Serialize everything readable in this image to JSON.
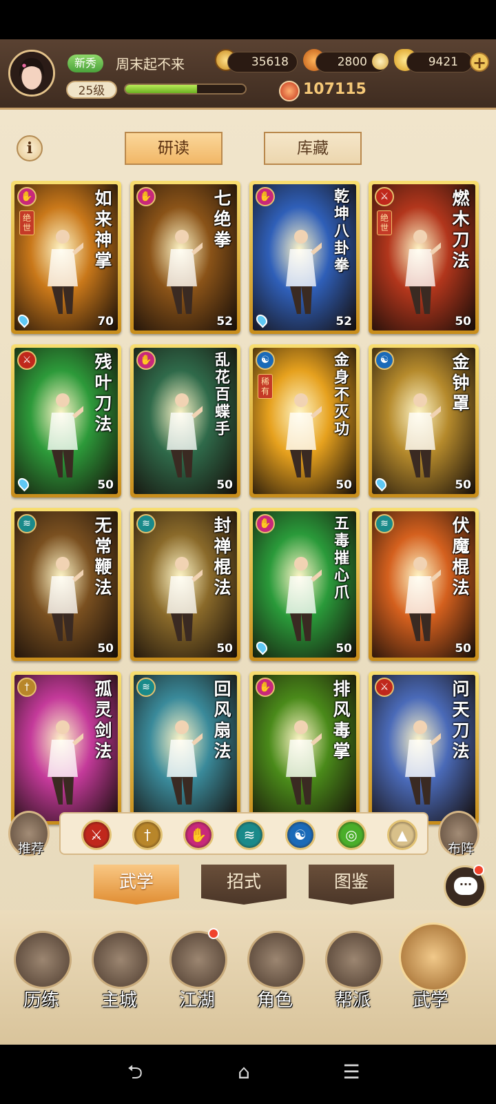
{
  "header": {
    "rank_badge": "新秀",
    "player_name": "周末起不来",
    "level": "25级",
    "exp_progress": 0.6,
    "coins": "35618",
    "leaf_currency": "2800",
    "gold_ingots": "9421",
    "add_label": "+",
    "combat_power": "107115"
  },
  "info_label": "i",
  "subtabs": [
    {
      "label": "研读",
      "active": true
    },
    {
      "label": "库藏",
      "active": false
    }
  ],
  "cards": [
    {
      "name": "如来神掌",
      "level": "70",
      "type": "palm",
      "rarity": "绝世",
      "drop": true,
      "color": "#c9781a"
    },
    {
      "name": "七绝拳",
      "level": "52",
      "type": "palm",
      "rarity": "",
      "drop": false,
      "color": "#8a5318"
    },
    {
      "name": "乾坤八卦拳",
      "level": "52",
      "type": "palm",
      "rarity": "",
      "drop": true,
      "color": "#2f5fb8"
    },
    {
      "name": "燃木刀法",
      "level": "50",
      "type": "blade",
      "rarity": "绝世",
      "drop": false,
      "color": "#b2361c"
    },
    {
      "name": "残叶刀法",
      "level": "50",
      "type": "blade",
      "rarity": "",
      "drop": true,
      "color": "#2d9a3a"
    },
    {
      "name": "乱花百蝶手",
      "level": "50",
      "type": "palm",
      "rarity": "",
      "drop": false,
      "color": "#2f6a4a"
    },
    {
      "name": "金身不灭功",
      "level": "50",
      "type": "inner",
      "rarity": "稀有",
      "drop": false,
      "color": "#e6a11e"
    },
    {
      "name": "金钟罩",
      "level": "50",
      "type": "inner",
      "rarity": "",
      "drop": true,
      "color": "#b58a2c"
    },
    {
      "name": "无常鞭法",
      "level": "50",
      "type": "whip",
      "rarity": "",
      "drop": false,
      "color": "#7a5020"
    },
    {
      "name": "封禅棍法",
      "level": "50",
      "type": "whip",
      "rarity": "",
      "drop": false,
      "color": "#8a6a2a"
    },
    {
      "name": "五毒摧心爪",
      "level": "50",
      "type": "palm",
      "rarity": "",
      "drop": true,
      "color": "#2a9a3a"
    },
    {
      "name": "伏魔棍法",
      "level": "50",
      "type": "whip",
      "rarity": "",
      "drop": false,
      "color": "#d4601e"
    },
    {
      "name": "孤灵剑法",
      "level": "",
      "type": "sword",
      "rarity": "",
      "drop": false,
      "color": "#c43a9a"
    },
    {
      "name": "回风扇法",
      "level": "",
      "type": "whip",
      "rarity": "",
      "drop": false,
      "color": "#3a8a9a"
    },
    {
      "name": "排风毒掌",
      "level": "",
      "type": "palm",
      "rarity": "",
      "drop": false,
      "color": "#4a8a1a"
    },
    {
      "name": "问天刀法",
      "level": "",
      "type": "blade",
      "rarity": "",
      "drop": false,
      "color": "#4a6ab8"
    }
  ],
  "filter": {
    "recommend_label": "推荐",
    "formation_label": "布阵",
    "icons": [
      {
        "name": "blade-filter-icon",
        "color": "#c0281c"
      },
      {
        "name": "sword-filter-icon",
        "color": "#b8862a"
      },
      {
        "name": "palm-filter-icon",
        "color": "#c8287a"
      },
      {
        "name": "whip-filter-icon",
        "color": "#1a8a8a"
      },
      {
        "name": "inner-filter-icon",
        "color": "#1a6ab8"
      },
      {
        "name": "light-filter-icon",
        "color": "#4aae2a"
      },
      {
        "name": "other-filter-icon",
        "color": "#d8c08a"
      }
    ]
  },
  "main_tabs": [
    {
      "label": "武学",
      "active": true
    },
    {
      "label": "招式",
      "active": false
    },
    {
      "label": "图鉴",
      "active": false
    }
  ],
  "chat_label": "···",
  "nav": [
    {
      "label": "历练",
      "active": false,
      "dot": false
    },
    {
      "label": "主城",
      "active": false,
      "dot": false
    },
    {
      "label": "江湖",
      "active": false,
      "dot": true
    },
    {
      "label": "角色",
      "active": false,
      "dot": false
    },
    {
      "label": "帮派",
      "active": false,
      "dot": false
    },
    {
      "label": "武学",
      "active": true,
      "dot": false
    }
  ],
  "system": {
    "back": "⮌",
    "home": "⌂",
    "menu": "☰"
  }
}
